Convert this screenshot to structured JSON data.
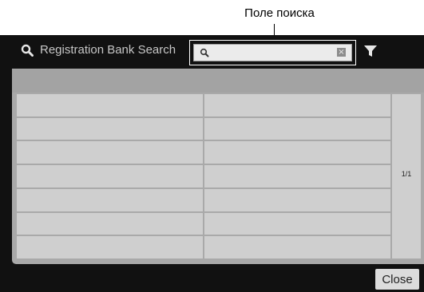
{
  "callout": {
    "label": "Поле поиска"
  },
  "header": {
    "title": "Registration Bank Search",
    "search": {
      "value": "",
      "placeholder": ""
    },
    "icons": [
      "search-icon",
      "clear-icon",
      "filter-icon"
    ]
  },
  "results": {
    "rows": [
      [
        "",
        ""
      ],
      [
        "",
        ""
      ],
      [
        "",
        ""
      ],
      [
        "",
        ""
      ],
      [
        "",
        ""
      ],
      [
        "",
        ""
      ],
      [
        "",
        ""
      ]
    ],
    "page_indicator": "1/1"
  },
  "footer": {
    "close_label": "Close"
  },
  "colors": {
    "panel_bg": "#111111",
    "cell_bg": "#cfcfcf",
    "header_bar": "#a3a3a3",
    "title_text": "#c7c7c7"
  }
}
